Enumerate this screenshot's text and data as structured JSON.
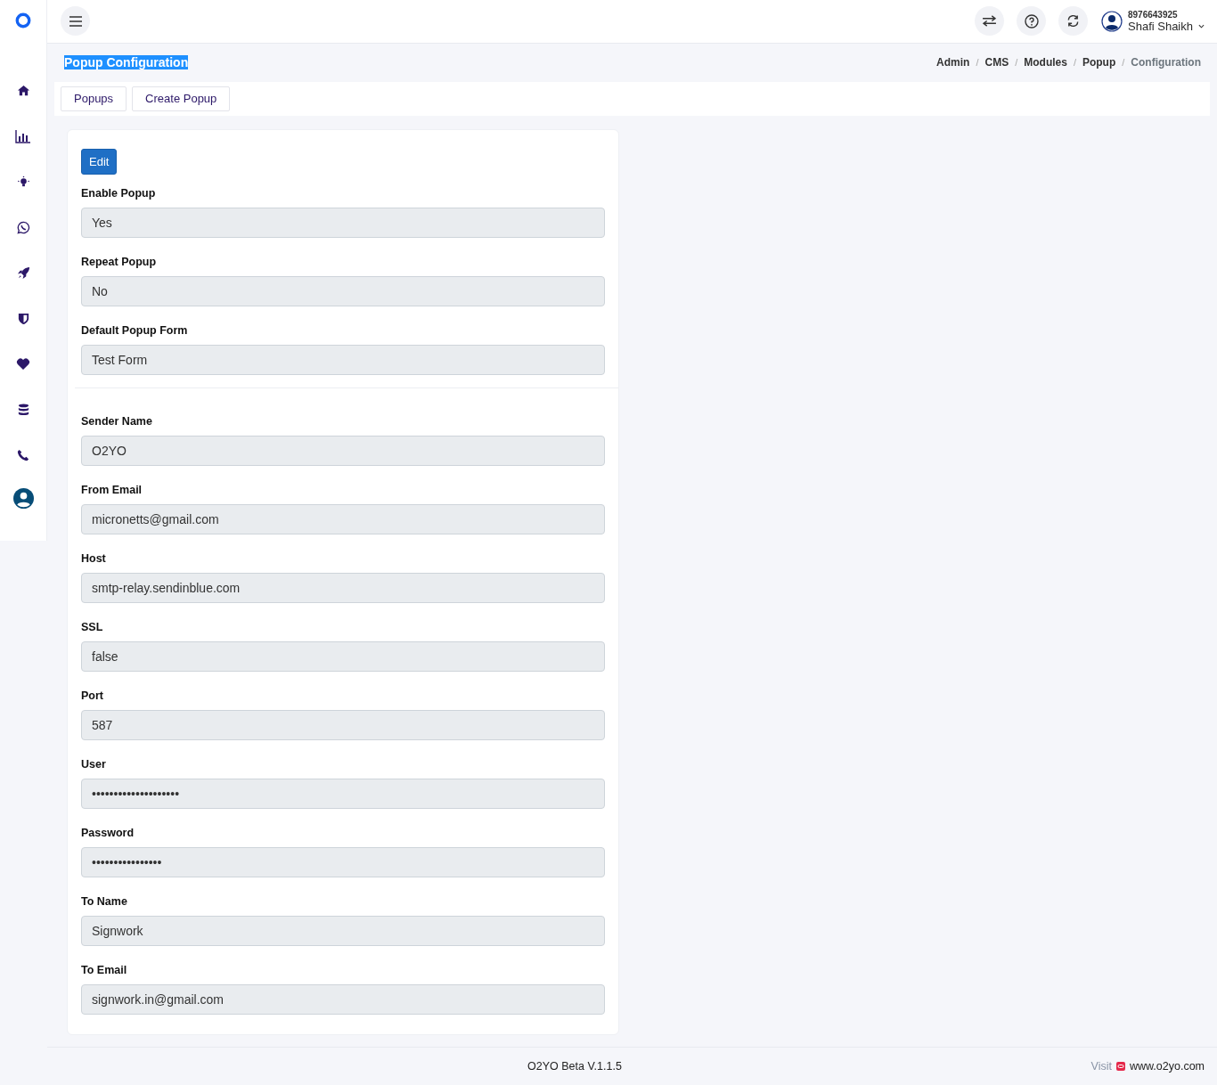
{
  "sidebar": {
    "items": [
      {
        "kind": "home"
      },
      {
        "kind": "chart"
      },
      {
        "kind": "bulb"
      },
      {
        "kind": "whatsapp"
      },
      {
        "kind": "rocket"
      },
      {
        "kind": "shield"
      },
      {
        "kind": "heart"
      },
      {
        "kind": "database"
      },
      {
        "kind": "phone"
      },
      {
        "kind": "user"
      }
    ]
  },
  "topbar": {
    "user": {
      "phone": "8976643925",
      "name": "Shafi Shaikh"
    }
  },
  "page": {
    "title": "Popup Configuration",
    "breadcrumb_separator": "/",
    "breadcrumb": [
      {
        "label": "Admin",
        "current": false
      },
      {
        "label": "CMS",
        "current": false
      },
      {
        "label": "Modules",
        "current": false
      },
      {
        "label": "Popup",
        "current": false
      },
      {
        "label": "Configuration",
        "current": true
      }
    ]
  },
  "tabs": [
    {
      "label": "Popups"
    },
    {
      "label": "Create Popup"
    }
  ],
  "card": {
    "edit_button": "Edit",
    "sections": [
      {
        "fields": [
          {
            "label": "Enable Popup",
            "value": "Yes"
          },
          {
            "label": "Repeat Popup",
            "value": "No"
          },
          {
            "label": "Default Popup Form",
            "value": "Test Form"
          }
        ]
      },
      {
        "fields": [
          {
            "label": "Sender Name",
            "value": "O2YO"
          },
          {
            "label": "From Email",
            "value": "micronetts@gmail.com"
          },
          {
            "label": "Host",
            "value": "smtp-relay.sendinblue.com"
          },
          {
            "label": "SSL",
            "value": "false"
          },
          {
            "label": "Port",
            "value": "587"
          },
          {
            "label": "User",
            "value": "••••••••••••••••••••"
          },
          {
            "label": "Password",
            "value": "••••••••••••••••"
          },
          {
            "label": "To Name",
            "value": "Signwork"
          },
          {
            "label": "To Email",
            "value": "signwork.in@gmail.com"
          }
        ]
      }
    ]
  },
  "footer": {
    "version": "O2YO Beta V.1.1.5",
    "visit": "Visit",
    "link": "www.o2yo.com"
  }
}
